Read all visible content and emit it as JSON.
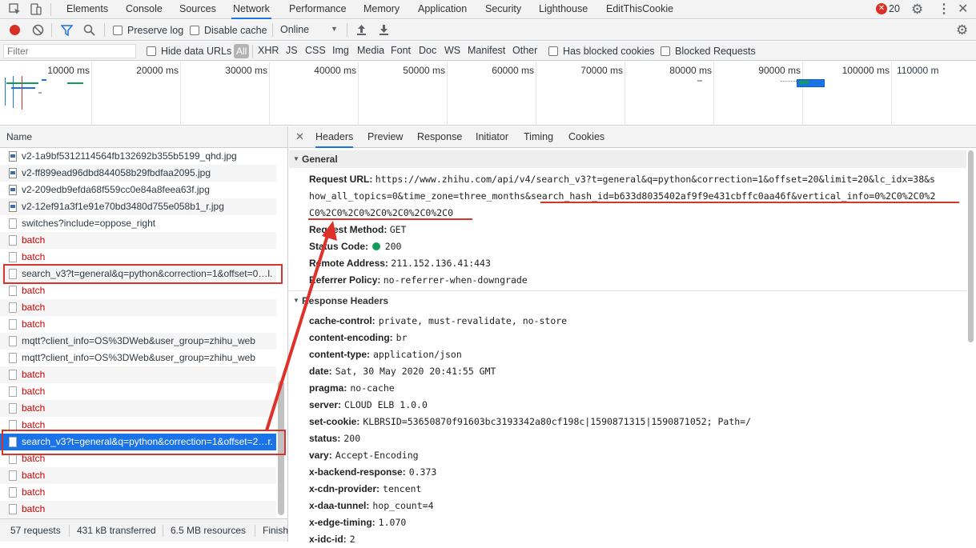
{
  "tabs": [
    "Elements",
    "Console",
    "Sources",
    "Network",
    "Performance",
    "Memory",
    "Application",
    "Security",
    "Lighthouse",
    "EditThisCookie"
  ],
  "error_count": "20",
  "toolbar": {
    "preserve_log": "Preserve log",
    "disable_cache": "Disable cache",
    "throttle": "Online"
  },
  "filter": {
    "placeholder": "Filter",
    "hide_data_urls": "Hide data URLs",
    "all": "All",
    "types": [
      "XHR",
      "JS",
      "CSS",
      "Img",
      "Media",
      "Font",
      "Doc",
      "WS",
      "Manifest",
      "Other"
    ],
    "has_blocked": "Has blocked cookies",
    "blocked_requests": "Blocked Requests"
  },
  "overview": {
    "ticks": [
      "10000 ms",
      "20000 ms",
      "30000 ms",
      "40000 ms",
      "50000 ms",
      "60000 ms",
      "70000 ms",
      "80000 ms",
      "90000 ms",
      "100000 ms",
      "110000 m"
    ]
  },
  "name_header": "Name",
  "requests": [
    {
      "name": "v2-1a9bf5312114564fb132692b355b5199_qhd.jpg",
      "type": "img"
    },
    {
      "name": "v2-ff899ead96dbd844058b29fbdfaa2095.jpg",
      "type": "img"
    },
    {
      "name": "v2-209edb9efda68f559cc0e84a8feea63f.jpg",
      "type": "img"
    },
    {
      "name": "v2-12ef91a3f1e91e70bd3480d755e058b1_r.jpg",
      "type": "img"
    },
    {
      "name": "switches?include=oppose_right",
      "type": "xhr"
    },
    {
      "name": "batch",
      "type": "err"
    },
    {
      "name": "batch",
      "type": "err"
    },
    {
      "name": "search_v3?t=general&q=python&correction=1&offset=0…l.",
      "type": "xhr"
    },
    {
      "name": "batch",
      "type": "err"
    },
    {
      "name": "batch",
      "type": "err"
    },
    {
      "name": "batch",
      "type": "err"
    },
    {
      "name": "mqtt?client_info=OS%3DWeb&user_group=zhihu_web",
      "type": "xhr"
    },
    {
      "name": "mqtt?client_info=OS%3DWeb&user_group=zhihu_web",
      "type": "xhr"
    },
    {
      "name": "batch",
      "type": "err"
    },
    {
      "name": "batch",
      "type": "err"
    },
    {
      "name": "batch",
      "type": "err"
    },
    {
      "name": "batch",
      "type": "err"
    },
    {
      "name": "search_v3?t=general&q=python&correction=1&offset=2…r.",
      "type": "sel"
    },
    {
      "name": "batch",
      "type": "err"
    },
    {
      "name": "batch",
      "type": "err"
    },
    {
      "name": "batch",
      "type": "err"
    },
    {
      "name": "batch",
      "type": "err"
    }
  ],
  "status": {
    "requests": "57 requests",
    "transferred": "431 kB transferred",
    "resources": "6.5 MB resources",
    "finish": "Finish"
  },
  "detail_tabs": [
    "Headers",
    "Preview",
    "Response",
    "Initiator",
    "Timing",
    "Cookies"
  ],
  "general": {
    "title": "General",
    "request_url_key": "Request URL:",
    "request_url_line1": "https://www.zhihu.com/api/v4/search_v3?t=general&q=python&correction=1&offset=20&limit=20&lc_idx=38&s",
    "request_url_line2": "how_all_topics=0&time_zone=three_months&search_hash_id=b633d8035402af9f9e431cbffc0aa46f&vertical_info=0%2C0%2C0%2",
    "request_url_line3": "C0%2C0%2C0%2C0%2C0%2C0%2C0",
    "method_key": "Request Method:",
    "method": "GET",
    "status_key": "Status Code:",
    "status": "200",
    "remote_key": "Remote Address:",
    "remote": "211.152.136.41:443",
    "referrer_key": "Referrer Policy:",
    "referrer": "no-referrer-when-downgrade"
  },
  "response_headers": {
    "title": "Response Headers",
    "items": [
      {
        "k": "cache-control:",
        "v": "private, must-revalidate, no-store"
      },
      {
        "k": "content-encoding:",
        "v": "br"
      },
      {
        "k": "content-type:",
        "v": "application/json"
      },
      {
        "k": "date:",
        "v": "Sat, 30 May 2020 20:41:55 GMT"
      },
      {
        "k": "pragma:",
        "v": "no-cache"
      },
      {
        "k": "server:",
        "v": "CLOUD ELB 1.0.0"
      },
      {
        "k": "set-cookie:",
        "v": "KLBRSID=53650870f91603bc3193342a80cf198c|1590871315|1590871052; Path=/"
      },
      {
        "k": "status:",
        "v": "200"
      },
      {
        "k": "vary:",
        "v": "Accept-Encoding"
      },
      {
        "k": "x-backend-response:",
        "v": "0.373"
      },
      {
        "k": "x-cdn-provider:",
        "v": "tencent"
      },
      {
        "k": "x-daa-tunnel:",
        "v": "hop_count=4"
      },
      {
        "k": "x-edge-timing:",
        "v": "1.070"
      },
      {
        "k": "x-idc-id:",
        "v": "2"
      }
    ]
  },
  "colors": {
    "accent": "#1a73e8",
    "error": "#c80000",
    "annotation": "#d9342b",
    "success": "#0f9d58"
  }
}
